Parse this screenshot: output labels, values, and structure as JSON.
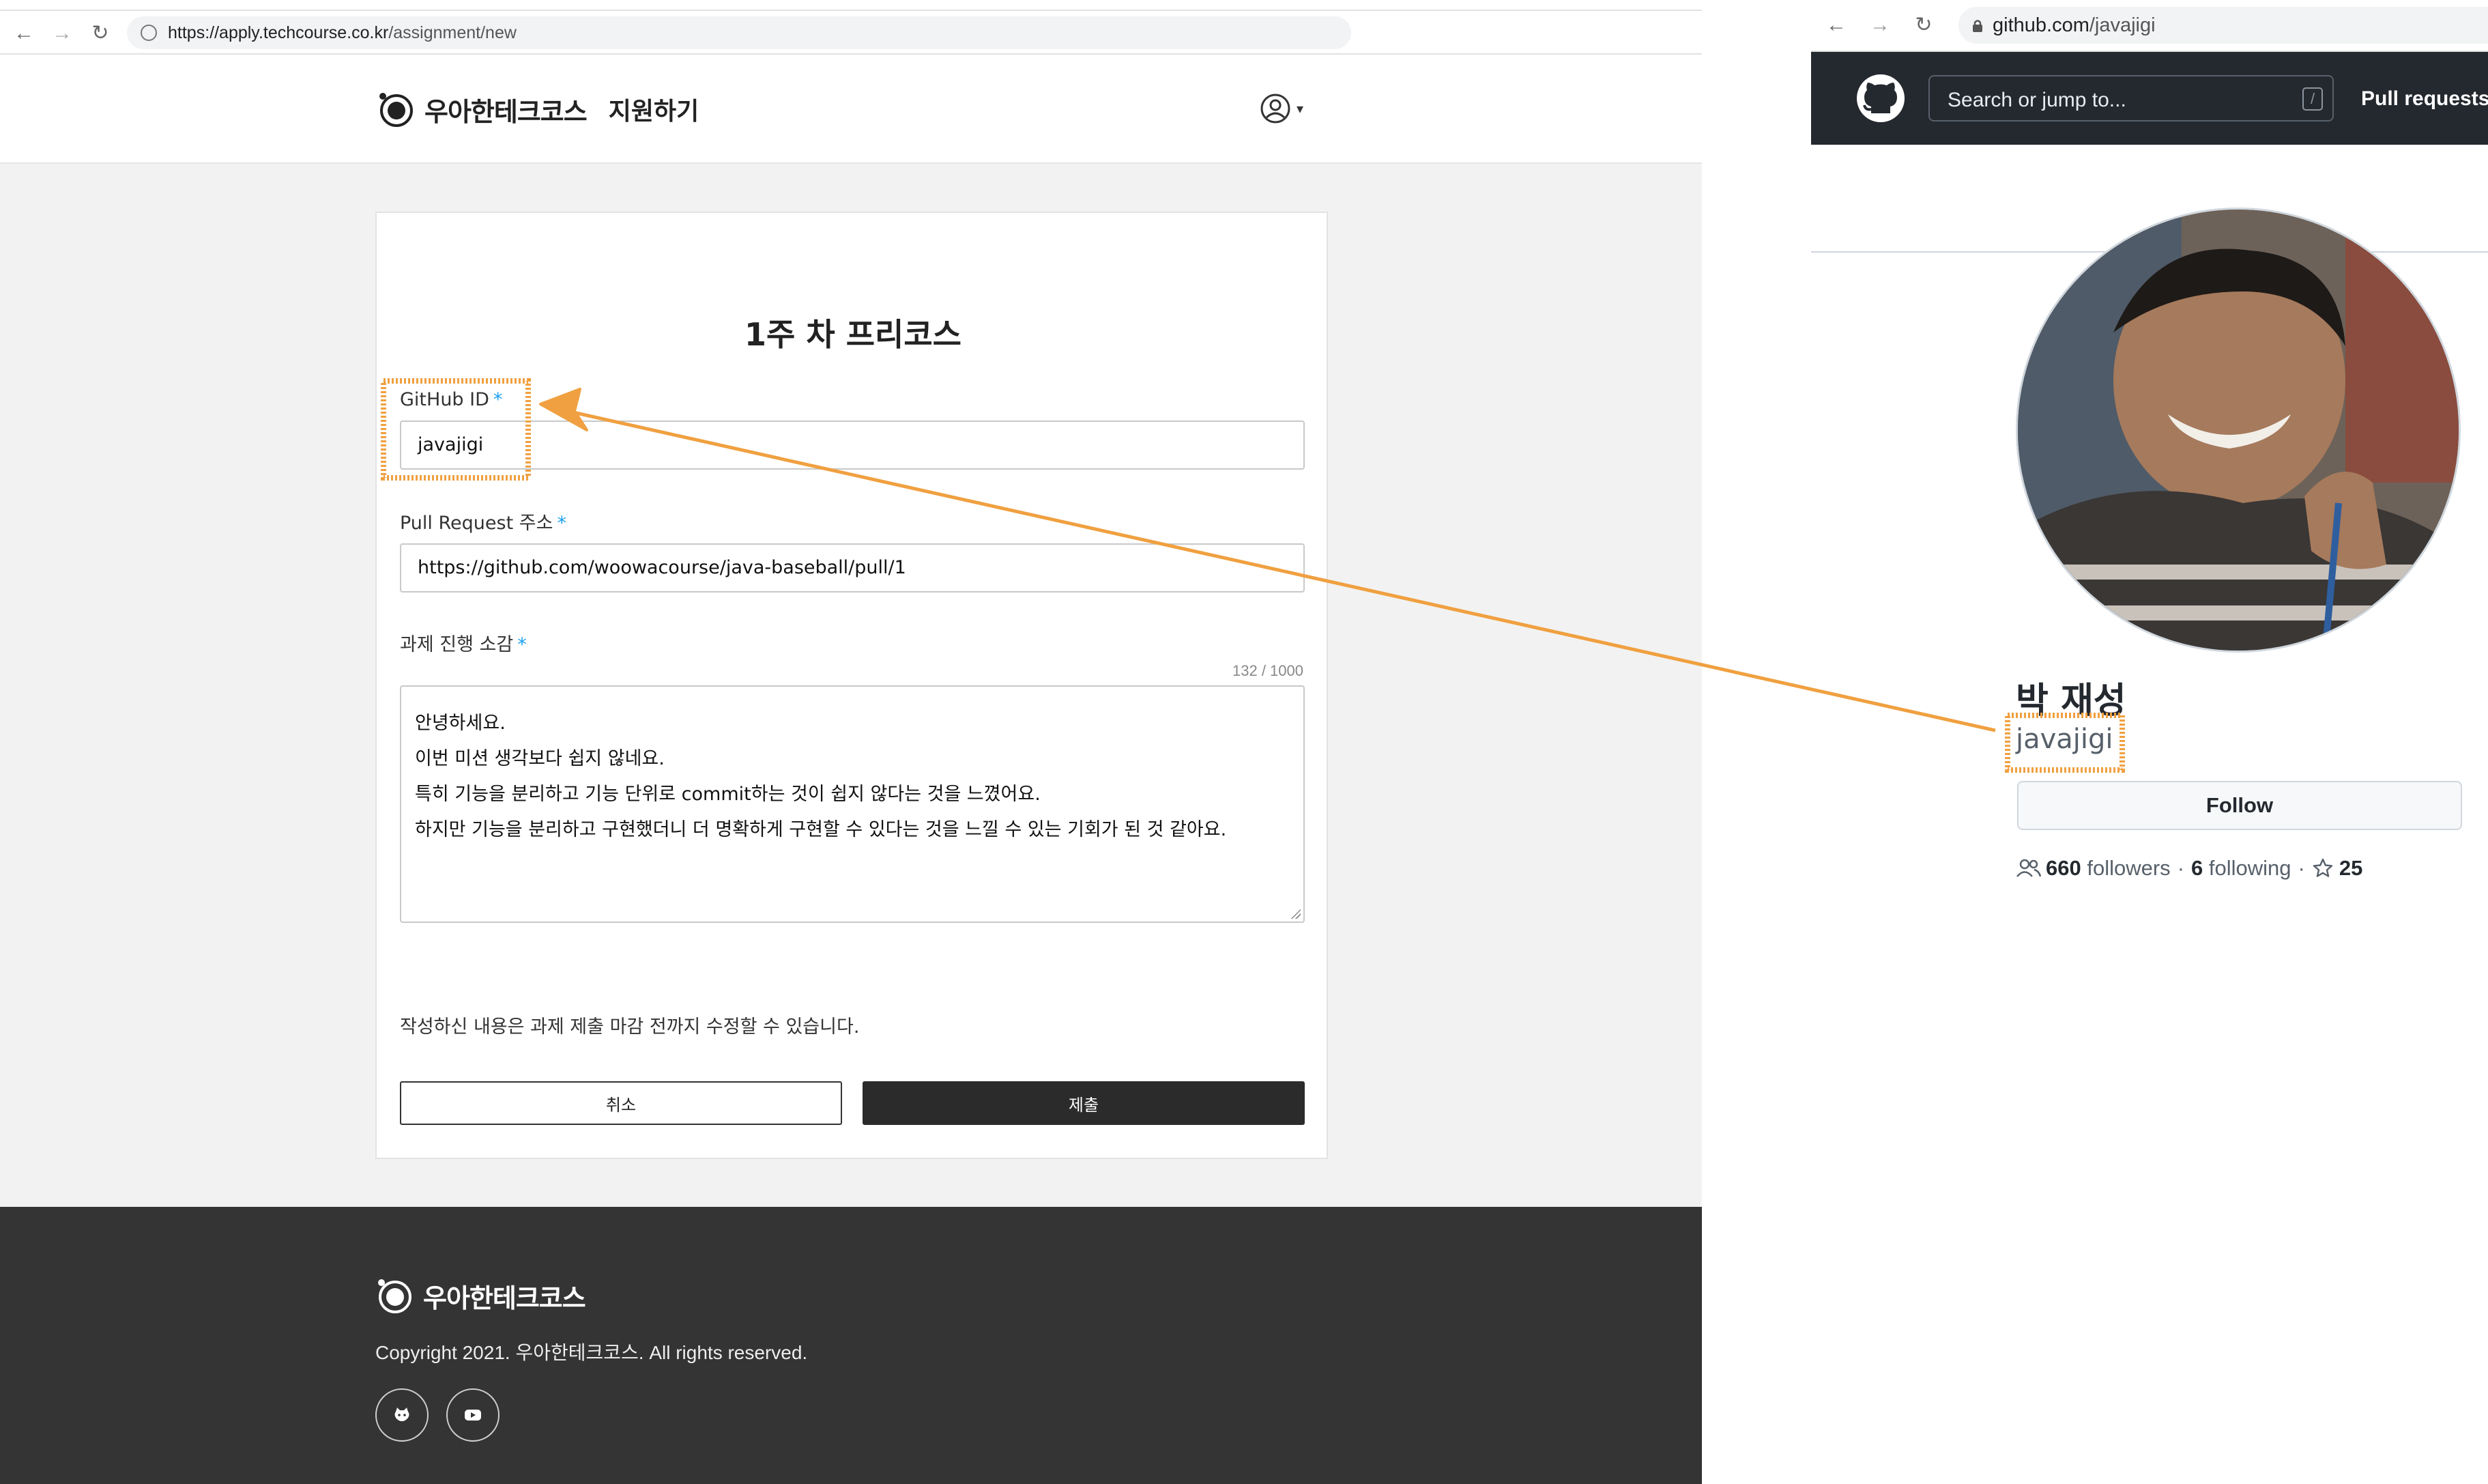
{
  "left_browser": {
    "url_scheme_host": "https://apply.techcourse.co.kr",
    "url_path": "/assignment/new"
  },
  "site": {
    "brand_name": "우아한테크코스",
    "nav_apply": "지원하기",
    "menu_caret": "▾"
  },
  "assignment": {
    "title": "1주 차 프리코스",
    "required_mark": "*",
    "github_id_label": "GitHub ID",
    "github_id_value": "javajigi",
    "pr_label": "Pull Request 주소",
    "pr_value": "https://github.com/woowacourse/java-baseball/pull/1",
    "impression_label": "과제 진행 소감",
    "char_count": "132 / 1000",
    "impression_lines": [
      "안녕하세요.",
      "이번 미션 생각보다 쉽지 않네요.",
      "특히 기능을 분리하고 기능 단위로 commit하는 것이 쉽지 않다는 것을 느꼈어요.",
      "하지만 기능을 분리하고 구현했더니 더 명확하게 구현할 수 있다는 것을 느낄 수 있는 기회가 된 것 같아요."
    ],
    "notice": "작성하신 내용은 과제 제출 마감 전까지 수정할 수 있습니다.",
    "cancel_label": "취소",
    "submit_label": "제출"
  },
  "footer": {
    "brand_name": "우아한테크코스",
    "copyright": "Copyright 2021. 우아한테크코스. All rights reserved.",
    "social_icons": [
      "github-icon",
      "youtube-icon"
    ]
  },
  "right_browser": {
    "url_host": "github.com",
    "url_path": "/javajigi"
  },
  "github": {
    "search_placeholder": "Search or jump to...",
    "search_shortcut": "/",
    "nav_pulls": "Pull requests",
    "full_name": "박 재성",
    "login": "javajigi",
    "follow_label": "Follow",
    "followers_count": "660",
    "followers_label": "followers",
    "following_count": "6",
    "following_label": "following",
    "separator": "·",
    "stars_count": "25"
  },
  "colors": {
    "highlight": "#f0a040",
    "required_mark": "#1da1f2",
    "footer_bg": "#343434",
    "github_header_bg": "#24292f",
    "main_bg": "#f2f2f2"
  }
}
